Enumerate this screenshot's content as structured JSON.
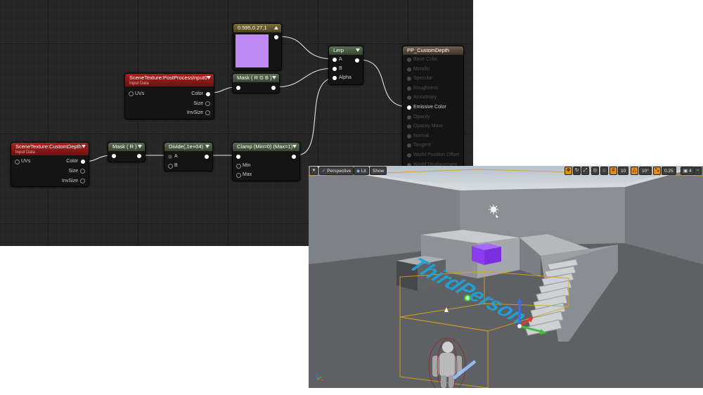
{
  "graph": {
    "nodes": {
      "constant": {
        "title": "0.595,0.27,1",
        "swatch": "#c08af5"
      },
      "lerp": {
        "title": "Lerp",
        "inputs": [
          "A",
          "B",
          "Alpha"
        ]
      },
      "output": {
        "title": "PP_CustomDepth",
        "inputs": [
          "Base Color",
          "Metallic",
          "Specular",
          "Roughness",
          "Anisotropy",
          "Emissive Color",
          "Opacity",
          "Opacity Mask",
          "Normal",
          "Tangent",
          "World Position Offset",
          "World Displacement"
        ],
        "active_input": "Emissive Color"
      },
      "scene_texture_pp": {
        "title": "SceneTexture:PostProcessInput0",
        "subtitle": "Input Data",
        "inputs": [
          "UVs"
        ],
        "outputs": [
          "Color",
          "Size",
          "InvSize"
        ]
      },
      "mask_rgb": {
        "title": "Mask ( R G B )"
      },
      "scene_texture_cd": {
        "title": "SceneTexture:CustomDepth",
        "subtitle": "Input Data",
        "inputs": [
          "UVs"
        ],
        "outputs": [
          "Color",
          "Size",
          "InvSize"
        ]
      },
      "mask_r": {
        "title": "Mask ( R )"
      },
      "divide": {
        "title": "Divide(,1e+04)",
        "inputs": [
          "A",
          "B"
        ]
      },
      "clamp": {
        "title": "Clamp (Min=0) (Max=1)",
        "inputs": [
          "Min",
          "Max"
        ]
      }
    }
  },
  "viewport": {
    "toolbar": {
      "perspective": "Perspective",
      "lit": "Lit",
      "show": "Show",
      "grid_snap": "10",
      "rotation_snap": "10°",
      "scale_snap": "0.25",
      "camera_speed": "4"
    },
    "floor_text": "ThirdPerson",
    "colors": {
      "purple_box": "#8a3cf0",
      "floor_text": "#1fa3d6",
      "bounds": "#d9a21b"
    }
  }
}
